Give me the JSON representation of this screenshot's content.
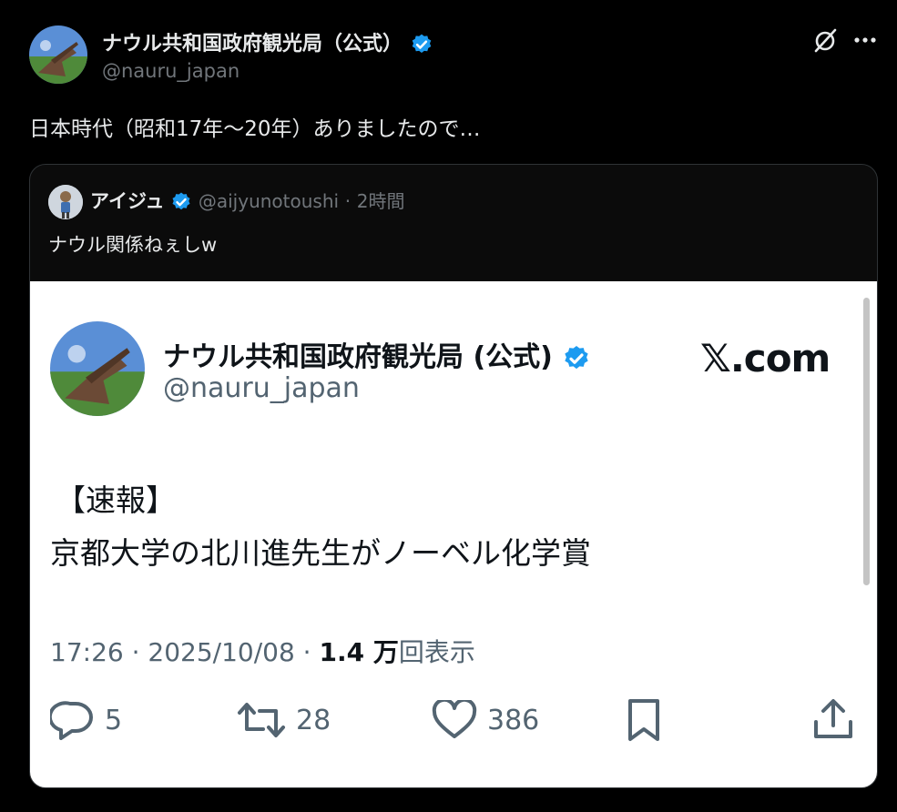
{
  "post": {
    "author_name": "ナウル共和国政府観光局（公式）",
    "author_handle": "@nauru_japan",
    "text": "日本時代（昭和17年〜20年）ありましたので…"
  },
  "quote": {
    "author_name": "アイジュ",
    "author_handle": "@aijyunotoushi",
    "separator": "·",
    "time": "2時間",
    "text": "ナウル関係ねぇしw"
  },
  "screenshot": {
    "author_name": "ナウル共和国政府観光局 (公式)",
    "author_handle": "@nauru_japan",
    "brand": "𝕏.com",
    "line1": "【速報】",
    "line2": "京都大学の北川進先生がノーベル化学賞",
    "meta_time": "17:26 · 2025/10/08 · ",
    "meta_views": "1.4 万",
    "meta_views_label": "回表示",
    "replies": "5",
    "reposts": "28",
    "likes": "386"
  },
  "icons": {
    "verified": "verified-badge-icon",
    "grok": "grok-icon",
    "more": "more-icon",
    "reply": "reply-icon",
    "repost": "repost-icon",
    "like": "like-icon",
    "bookmark": "bookmark-icon",
    "share": "share-icon"
  },
  "colors": {
    "background": "#000000",
    "verified": "#1d9bf0",
    "secondary_text": "#71767b",
    "screenshot_meta": "#536471"
  }
}
